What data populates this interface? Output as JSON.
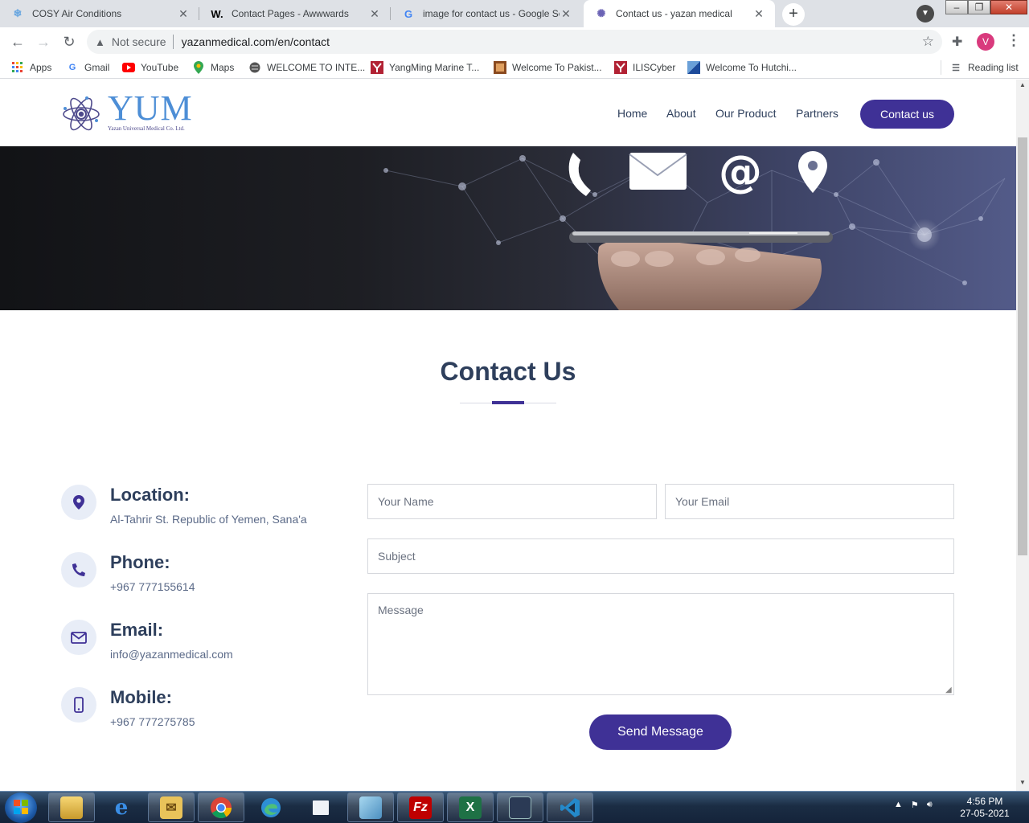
{
  "browser": {
    "tabs": [
      {
        "title": "COSY Air Conditions",
        "icon": "snowflake-icon"
      },
      {
        "title": "Contact Pages - Awwwards",
        "icon": "w-logo-icon"
      },
      {
        "title": "image for contact us - Google Se",
        "icon": "google-icon"
      },
      {
        "title": "Contact us - yazan medical",
        "icon": "atom-icon",
        "active": true
      }
    ],
    "address": {
      "security": "Not secure",
      "url": "yazanmedical.com/en/contact"
    },
    "profile_initial": "V",
    "bookmarks": [
      {
        "label": "Apps",
        "icon": "apps-grid-icon"
      },
      {
        "label": "Gmail",
        "icon": "google-icon"
      },
      {
        "label": "YouTube",
        "icon": "youtube-icon"
      },
      {
        "label": "Maps",
        "icon": "maps-pin-icon"
      },
      {
        "label": "WELCOME TO INTE...",
        "icon": "globe-icon"
      },
      {
        "label": "YangMing Marine T...",
        "icon": "ym-logo-icon"
      },
      {
        "label": "Welcome To Pakist...",
        "icon": "pk-logo-icon"
      },
      {
        "label": "ILISCyber",
        "icon": "ym-logo-icon"
      },
      {
        "label": "Welcome To Hutchi...",
        "icon": "hutchison-icon"
      }
    ],
    "reading_list": "Reading list"
  },
  "site": {
    "logo": {
      "name": "YUM",
      "tagline": "Yazan Universal Medical Co. Ltd."
    },
    "nav": [
      "Home",
      "About",
      "Our Product",
      "Partners"
    ],
    "cta": "Contact us"
  },
  "contact": {
    "title": "Contact Us",
    "info": [
      {
        "label": "Location:",
        "value": "Al-Tahrir St. Republic of Yemen, Sana'a",
        "icon": "map-pin-icon"
      },
      {
        "label": "Phone:",
        "value": "+967 777155614",
        "icon": "phone-icon"
      },
      {
        "label": "Email:",
        "value": "info@yazanmedical.com",
        "icon": "envelope-icon"
      },
      {
        "label": "Mobile:",
        "value": "+967 777275785",
        "icon": "mobile-icon"
      }
    ],
    "form": {
      "name_placeholder": "Your Name",
      "email_placeholder": "Your Email",
      "subject_placeholder": "Subject",
      "message_placeholder": "Message",
      "submit": "Send Message"
    }
  },
  "taskbar": {
    "time": "4:56 PM",
    "date": "27-05-2021"
  },
  "colors": {
    "brand": "#3f3196",
    "heading": "#2e3f5c",
    "logo_blue": "#4d8ed6"
  }
}
